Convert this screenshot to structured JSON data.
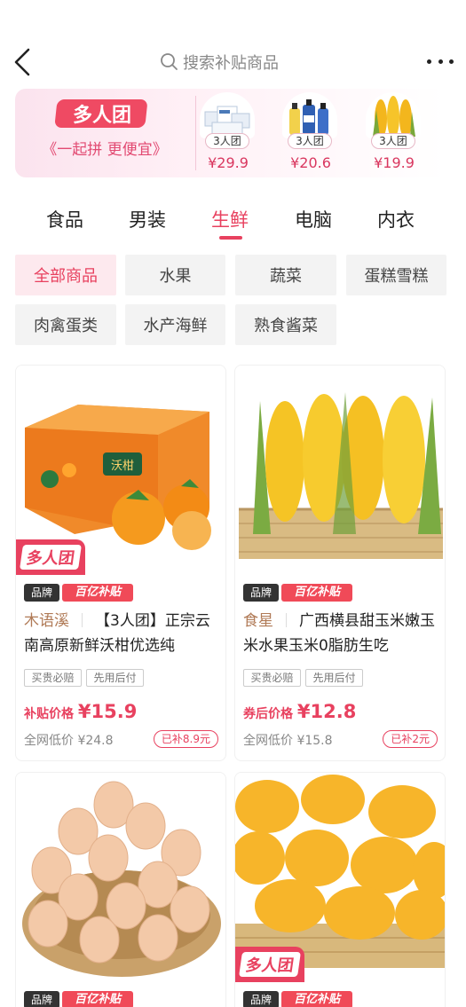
{
  "header": {
    "search_placeholder": "搜索补贴商品"
  },
  "banner": {
    "logo_text": "多人团",
    "slogan": "《一起拼 更便宜》",
    "deals": [
      {
        "badge": "3人团",
        "price": "¥29.9"
      },
      {
        "badge": "3人团",
        "price": "¥20.6"
      },
      {
        "badge": "3人团",
        "price": "¥19.9"
      }
    ]
  },
  "tabs": [
    "食品",
    "男装",
    "生鲜",
    "电脑",
    "内衣"
  ],
  "active_tab": "生鲜",
  "filters": [
    "全部商品",
    "水果",
    "蔬菜",
    "蛋糕雪糕",
    "肉禽蛋类",
    "水产海鲜",
    "熟食酱菜"
  ],
  "active_filter": "全部商品",
  "products": [
    {
      "sticker": "多人团",
      "tag_brand": "品牌",
      "tag_subsidy": "百亿补贴",
      "brand": "木语溪",
      "title": "【3人团】正宗云南高原新鲜沃柑优选纯",
      "services": [
        "买贵必赔",
        "先用后付"
      ],
      "price_label": "补贴价格",
      "price": "¥15.9",
      "ref_price": "全网低价 ¥24.8",
      "saved": "已补8.9元",
      "box_label": "沃柑"
    },
    {
      "tag_brand": "品牌",
      "tag_subsidy": "百亿补贴",
      "brand": "食星",
      "title": "广西横县甜玉米嫩玉米水果玉米0脂肪生吃",
      "services": [
        "买贵必赔",
        "先用后付"
      ],
      "price_label": "券后价格",
      "price": "¥12.8",
      "ref_price": "全网低价 ¥15.8",
      "saved": "已补2元"
    },
    {
      "tag_brand": "品牌",
      "tag_subsidy": "百亿补贴"
    },
    {
      "sticker": "多人团",
      "tag_brand": "品牌",
      "tag_subsidy": "百亿补贴"
    }
  ],
  "colors": {
    "accent": "#e8415f",
    "brand_text": "#b07a56"
  }
}
